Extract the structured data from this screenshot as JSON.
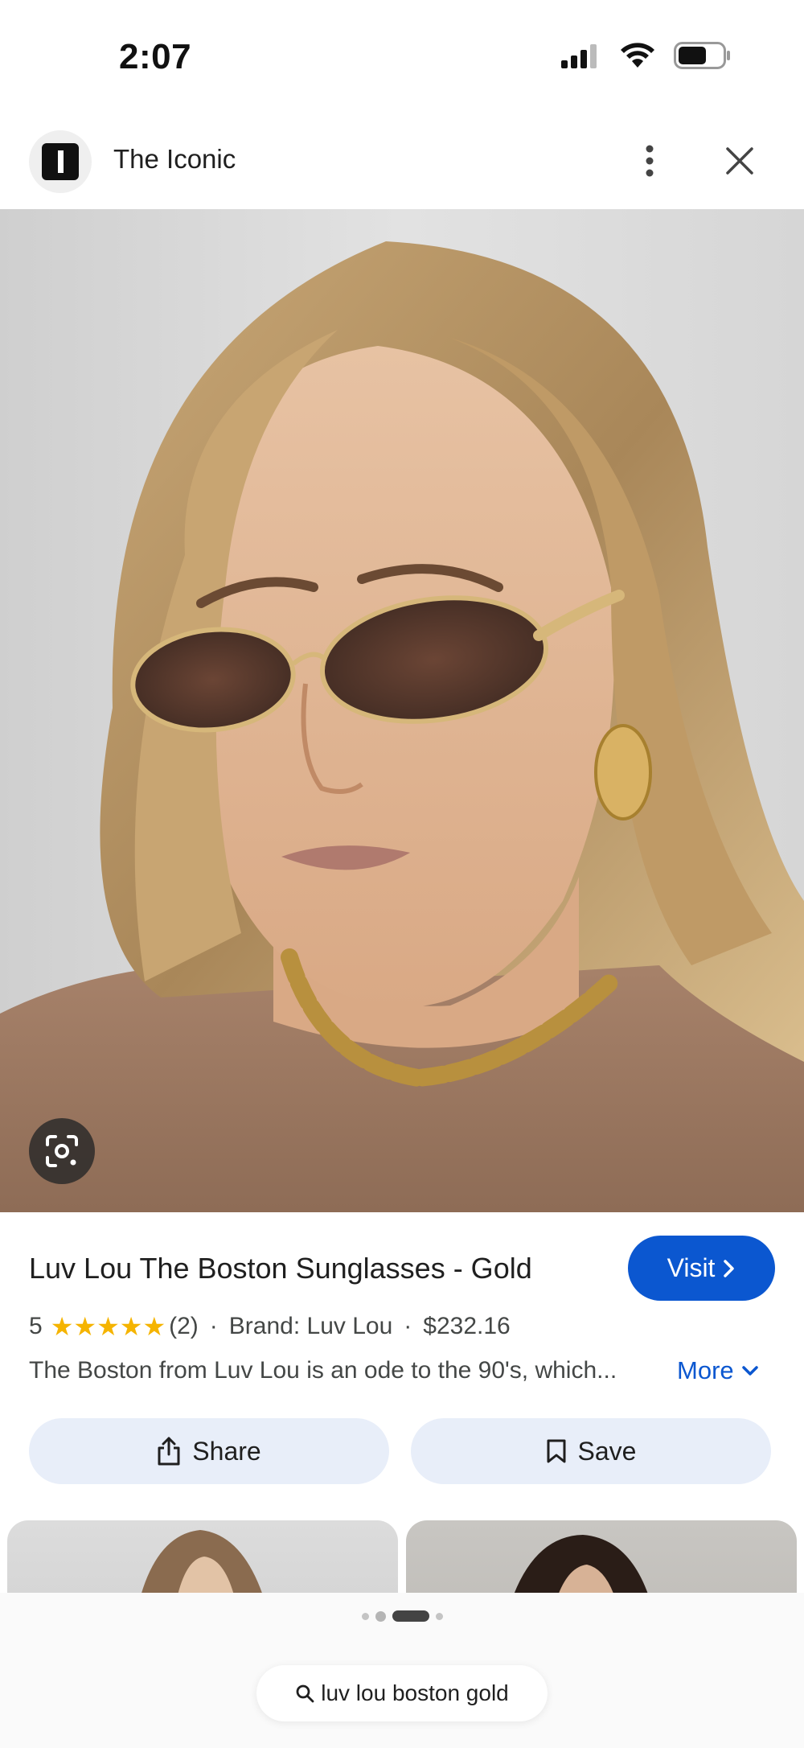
{
  "status_bar": {
    "time": "2:07",
    "icons": [
      "cellular-signal-icon",
      "wifi-icon",
      "battery-icon"
    ]
  },
  "header": {
    "site_name": "The Iconic",
    "logo_icon": "the-iconic-logo",
    "menu_icon": "more-vertical-icon",
    "close_icon": "close-icon"
  },
  "hero": {
    "alt": "Luv Lou The Boston Sunglasses - Gold",
    "lens_icon": "google-lens-icon"
  },
  "product": {
    "title": "Luv Lou The Boston Sunglasses - Gold",
    "visit_label": "Visit",
    "rating": "5",
    "rating_stars": 5,
    "review_count": "(2)",
    "brand": "Brand: Luv Lou",
    "price": "$232.16",
    "description": "The Boston from Luv Lou is an ode to the 90's, which...",
    "more_label": "More"
  },
  "actions": {
    "share_label": "Share",
    "save_label": "Save"
  },
  "pagination": {
    "active_index": 2,
    "count": 4
  },
  "search": {
    "query": "luv lou boston gold"
  },
  "colors": {
    "accent": "#0b57d0",
    "star": "#f5b400",
    "action_bg": "#e8eef9"
  }
}
